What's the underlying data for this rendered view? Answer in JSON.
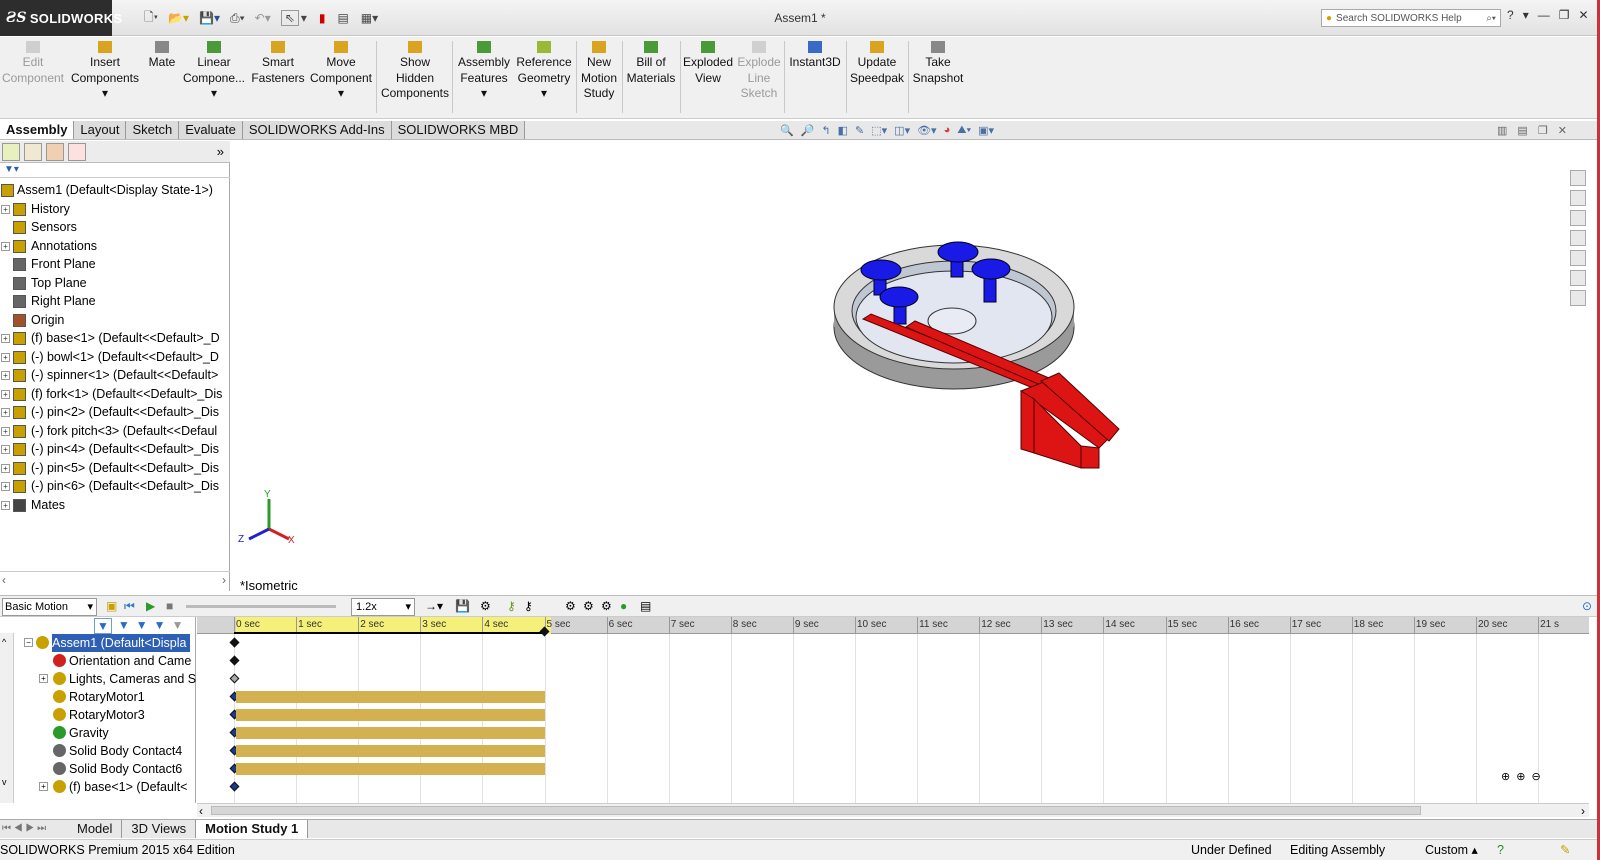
{
  "app": {
    "logo": "SOLIDWORKS",
    "document_title": "Assem1 *",
    "search_placeholder": "Search SOLIDWORKS Help",
    "help": "?"
  },
  "ribbon": {
    "buttons": [
      {
        "label": "Edit Component",
        "disabled": true
      },
      {
        "label": "Insert Components",
        "disabled": false
      },
      {
        "label": "Mate",
        "disabled": false
      },
      {
        "label": "Linear Compone...",
        "disabled": false
      },
      {
        "label": "Smart Fasteners",
        "disabled": false
      },
      {
        "label": "Move Component",
        "disabled": false
      },
      {
        "label": "Show Hidden Components",
        "disabled": false
      },
      {
        "label": "Assembly Features",
        "disabled": false
      },
      {
        "label": "Reference Geometry",
        "disabled": false
      },
      {
        "label": "New Motion Study",
        "disabled": false
      },
      {
        "label": "Bill of Materials",
        "disabled": false
      },
      {
        "label": "Exploded View",
        "disabled": false
      },
      {
        "label": "Explode Line Sketch",
        "disabled": true
      },
      {
        "label": "Instant3D",
        "disabled": false
      },
      {
        "label": "Update Speedpak",
        "disabled": false
      },
      {
        "label": "Take Snapshot",
        "disabled": false
      }
    ]
  },
  "tabs": [
    "Assembly",
    "Layout",
    "Sketch",
    "Evaluate",
    "SOLIDWORKS Add-Ins",
    "SOLIDWORKS MBD"
  ],
  "feature_tree": {
    "items": [
      {
        "label": "Assem1  (Default<Display State-1>)",
        "icon": "assembly-icon",
        "expand": ""
      },
      {
        "label": "History",
        "icon": "history-icon",
        "expand": "+"
      },
      {
        "label": "Sensors",
        "icon": "sensors-icon",
        "expand": ""
      },
      {
        "label": "Annotations",
        "icon": "annotations-icon",
        "expand": "+"
      },
      {
        "label": "Front Plane",
        "icon": "plane-icon",
        "expand": ""
      },
      {
        "label": "Top Plane",
        "icon": "plane-icon",
        "expand": ""
      },
      {
        "label": "Right Plane",
        "icon": "plane-icon",
        "expand": ""
      },
      {
        "label": "Origin",
        "icon": "origin-icon",
        "expand": ""
      },
      {
        "label": "(f) base<1> (Default<<Default>_D",
        "icon": "part-icon",
        "expand": "+"
      },
      {
        "label": "(-) bowl<1> (Default<<Default>_D",
        "icon": "part-icon",
        "expand": "+"
      },
      {
        "label": "(-) spinner<1> (Default<<Default>",
        "icon": "part-icon",
        "expand": "+"
      },
      {
        "label": "(f) fork<1> (Default<<Default>_Dis",
        "icon": "part-icon",
        "expand": "+"
      },
      {
        "label": "(-) pin<2> (Default<<Default>_Dis",
        "icon": "part-icon",
        "expand": "+"
      },
      {
        "label": "(-) fork pitch<3> (Default<<Defaul",
        "icon": "part-icon",
        "expand": "+"
      },
      {
        "label": "(-) pin<4> (Default<<Default>_Dis",
        "icon": "part-icon",
        "expand": "+"
      },
      {
        "label": "(-) pin<5> (Default<<Default>_Dis",
        "icon": "part-icon",
        "expand": "+"
      },
      {
        "label": "(-) pin<6> (Default<<Default>_Dis",
        "icon": "part-icon",
        "expand": "+"
      },
      {
        "label": "Mates",
        "icon": "mates-icon",
        "expand": "+"
      }
    ]
  },
  "viewport": {
    "view_label": "*Isometric",
    "triad": {
      "x": "X",
      "y": "Y",
      "z": "Z"
    }
  },
  "motion": {
    "type": "Basic Motion",
    "zoom": "1.2x",
    "ruler": [
      "0 sec",
      "1 sec",
      "2 sec",
      "3 sec",
      "4 sec",
      "5 sec",
      "6 sec",
      "7 sec",
      "8 sec",
      "9 sec",
      "10 sec",
      "11 sec",
      "12 sec",
      "13 sec",
      "14 sec",
      "15 sec",
      "16 sec",
      "17 sec",
      "18 sec",
      "19 sec",
      "20 sec",
      "21 s"
    ],
    "tree": [
      {
        "label": "Assem1  (Default<Displa",
        "selected": true
      },
      {
        "label": "Orientation and Came"
      },
      {
        "label": "Lights, Cameras and Sc"
      },
      {
        "label": "RotaryMotor1"
      },
      {
        "label": "RotaryMotor3"
      },
      {
        "label": "Gravity"
      },
      {
        "label": "Solid Body Contact4"
      },
      {
        "label": "Solid Body Contact6"
      },
      {
        "label": "(f) base<1> (Default<"
      }
    ]
  },
  "bottom_tabs": [
    "Model",
    "3D Views",
    "Motion Study 1"
  ],
  "status": {
    "edition": "SOLIDWORKS Premium 2015 x64 Edition",
    "state": "Under Defined",
    "mode": "Editing Assembly",
    "units": "Custom"
  },
  "colors": {
    "accent": "#2d5fb5",
    "part_blue": "#1a1ae6",
    "part_red": "#dc1414",
    "timeline_bar": "#d4b150"
  }
}
